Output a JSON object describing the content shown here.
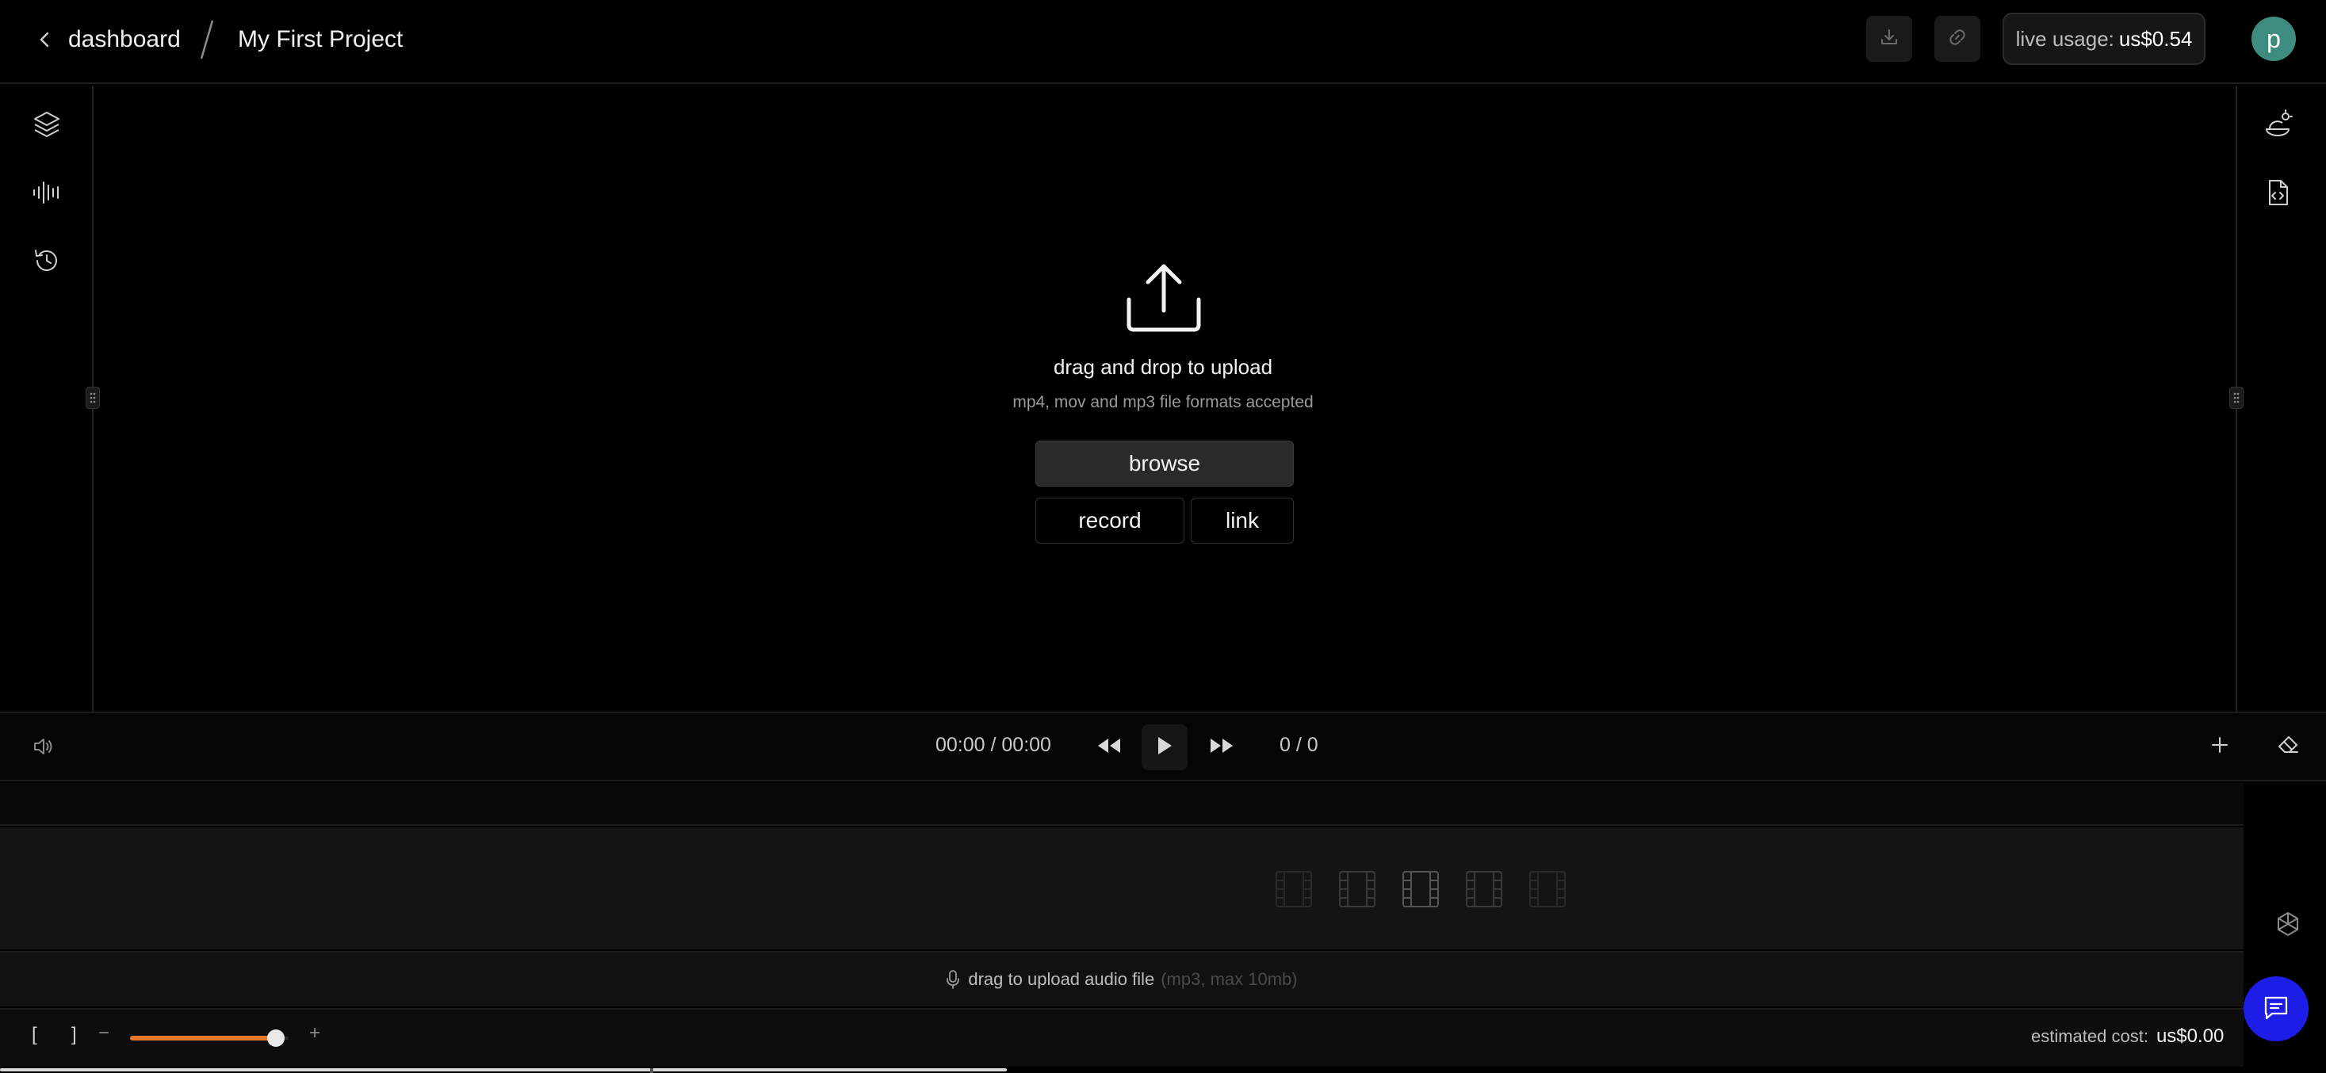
{
  "header": {
    "back_label": "dashboard",
    "project_name": "My First Project",
    "usage_label": "live usage:",
    "usage_value": "us$0.54",
    "avatar_initial": "p"
  },
  "upload": {
    "title": "drag and drop to upload",
    "subtitle": "mp4, mov and mp3 file formats accepted",
    "browse_label": "browse",
    "record_label": "record",
    "link_label": "link"
  },
  "transport": {
    "time": "00:00 / 00:00",
    "frame_count": "0 / 0"
  },
  "timeline": {
    "audio_hint": "drag to upload audio file",
    "audio_hint_detail": "(mp3, max 10mb)",
    "zoom_level": 0.92,
    "estimated_cost_label": "estimated cost:",
    "estimated_cost_value": "us$0.00",
    "bracket_open": "[",
    "bracket_close": "]",
    "zoom_minus": "−",
    "zoom_plus": "+"
  },
  "icons": {
    "left_rail": [
      "layers-icon",
      "audio-waveform-icon",
      "history-icon"
    ],
    "right_rail": [
      "ai-avatar-icon",
      "file-code-icon"
    ]
  },
  "colors": {
    "accent": "#e8772e",
    "avatar": "#3e8c7f",
    "chat": "#1d1de8"
  }
}
